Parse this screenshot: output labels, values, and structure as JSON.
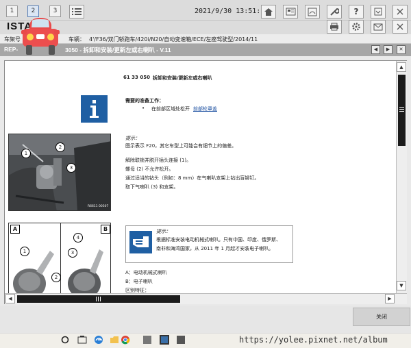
{
  "topbar": {
    "tabs": [
      "1",
      "2",
      "3"
    ],
    "datetime": "2021/9/30 13:51:19",
    "help_label": "?"
  },
  "app": {
    "title": "ISTA"
  },
  "vehicle": {
    "frame_label": "车架号",
    "vehicle_label": "车辆：",
    "vehicle_value": "4'/F36/双门轿跑车/420i/N20/自动变速箱/ECE/左座驾驶型/2014/11"
  },
  "document": {
    "title_prefix": "REP-",
    "title": "3050 - 拆卸和安装/更新左或右喇叭 - V.11",
    "heading_code": "61 33 050",
    "heading": "拆卸和安装/更新左或右喇叭",
    "prep_title": "需要的准备工作：",
    "prep_bullet_prefix": "在前部区域处松开",
    "prep_link": "前部轮罩盖",
    "hint1_title": "提示：",
    "hint1_text": "图示表示 F20，其它车型上可能会有细节上的偏差。",
    "steps": [
      "解除联锁并脱开插头连接 (1)。",
      "螺母 (2) 不允许松开。",
      "通过适当的钻头（例如：8 mm）在气喇叭支架上钻出盲铆钉。",
      "取下气喇叭 (3) 和支架。"
    ],
    "img1_callouts": [
      "1",
      "2",
      "3"
    ],
    "img1_code": "R6611 00307",
    "img2_labels": [
      "A",
      "B"
    ],
    "img2_callouts": [
      "1",
      "2",
      "3",
      "4"
    ],
    "hint2_title": "提示：",
    "hint2_lines": [
      "根据标准安装电动机械式喇叭。只有中国、印度、俄罗斯、",
      "南非和海湾国家，从 2011 年 1 月起才安装电子喇叭。"
    ],
    "legend_a": "A：电动机械式喇叭",
    "legend_b": "B：电子喇叭",
    "diff_label": "区别特征："
  },
  "footer": {
    "close_label": "关闭"
  },
  "watermark": "https://yolee.pixnet.net/album",
  "colors": {
    "header_gray": "#a6a6a6",
    "info_blue": "#1f5fa3",
    "link_blue": "#1a4ea0"
  }
}
